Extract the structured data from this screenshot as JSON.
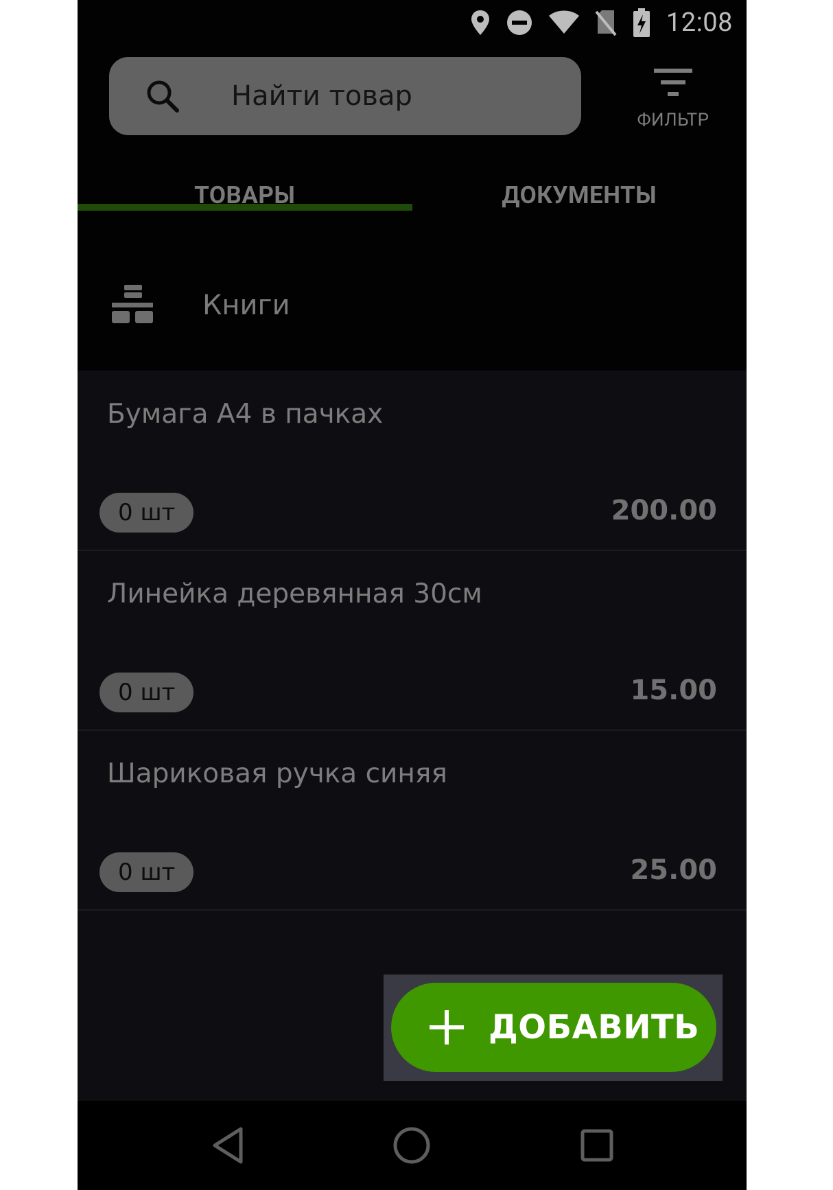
{
  "status_bar": {
    "time": "12:08",
    "icons": [
      "location-icon",
      "do-not-disturb-icon",
      "wifi-icon",
      "no-sim-icon",
      "battery-charging-icon"
    ]
  },
  "search": {
    "placeholder": "Найти товар",
    "value": ""
  },
  "filter": {
    "label": "ФИЛЬТР",
    "icon": "filter-icon"
  },
  "tabs": [
    {
      "label": "ТОВАРЫ",
      "active": true
    },
    {
      "label": "ДОКУМЕНТЫ",
      "active": false
    }
  ],
  "category": {
    "label": "Книги",
    "icon": "category-group-icon"
  },
  "products": [
    {
      "name": "Бумага А4 в пачках",
      "qty": "0 шт",
      "price": "200.00"
    },
    {
      "name": "Линейка деревянная 30см",
      "qty": "0 шт",
      "price": "15.00"
    },
    {
      "name": "Шариковая ручка синяя",
      "qty": "0 шт",
      "price": "25.00"
    }
  ],
  "fab": {
    "label": "ДОБАВИТЬ",
    "icon": "plus-icon"
  },
  "nav": {
    "icons": [
      "back-icon",
      "home-icon",
      "recents-icon"
    ]
  },
  "colors": {
    "accent": "#3f9800",
    "tab_indicator": "#1f4a08",
    "background": "#0e0e12"
  }
}
